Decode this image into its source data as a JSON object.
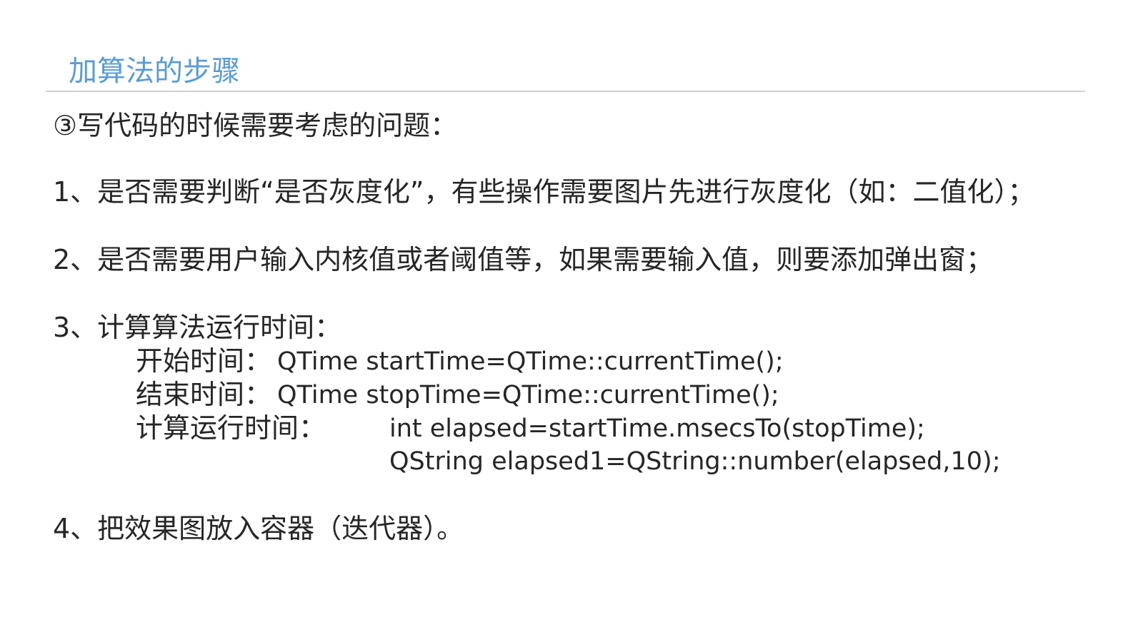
{
  "slide": {
    "title": "加算法的步骤",
    "subtitle": "③写代码的时候需要考虑的问题：",
    "items": [
      {
        "text": "1、是否需要判断“是否灰度化”，有些操作需要图片先进行灰度化（如：二值化）；"
      },
      {
        "text": "2、是否需要用户输入内核值或者阈值等，如果需要输入值，则要添加弹出窗；"
      },
      {
        "text": "3、计算算法运行时间：",
        "details": {
          "start_label": "开始时间：",
          "start_code": "QTime startTime=QTime::currentTime();",
          "stop_label": "结束时间：",
          "stop_code": "QTime stopTime=QTime::currentTime();",
          "elapsed_label": "计算运行时间：",
          "elapsed_code_1": "int elapsed=startTime.msecsTo(stopTime);",
          "elapsed_code_2": "QString elapsed1=QString::number(elapsed,10);"
        }
      },
      {
        "text": "4、把效果图放入容器（迭代器）。"
      }
    ],
    "colors": {
      "title": "#5b9bd5",
      "body_text": "#262626",
      "rule": "#d0d0d0"
    }
  }
}
